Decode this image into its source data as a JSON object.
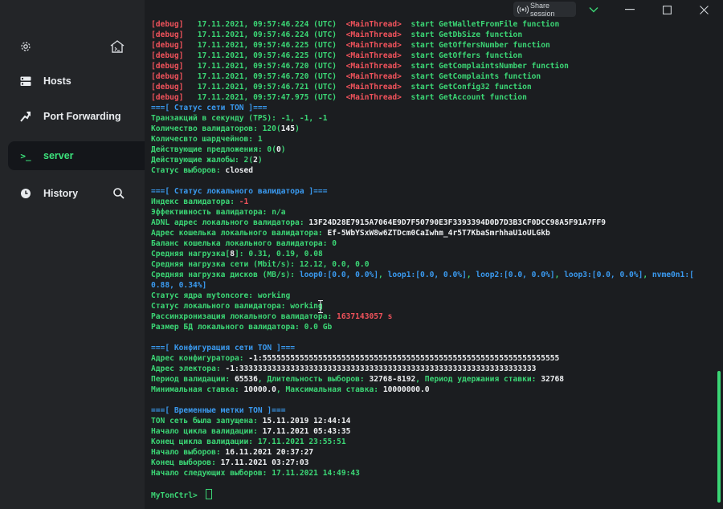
{
  "sidebar": {
    "hosts_label": "Hosts",
    "port_forwarding_label": "Port Forwarding",
    "server_label": "server",
    "history_label": "History",
    "server_icon_text": ">_"
  },
  "titlebar": {
    "share_session_label": "Share session"
  },
  "colors": {
    "accent_green": "#3bd675",
    "debug_red": "#f0525b",
    "info_blue": "#3a9af0"
  },
  "terminal": {
    "debug_lines": [
      {
        "tag": "[debug]",
        "time": "17.11.2021, 09:57:46.224 (UTC)",
        "thread": "<MainThread>",
        "msg": "start GetWalletFromFile function"
      },
      {
        "tag": "[debug]",
        "time": "17.11.2021, 09:57:46.224 (UTC)",
        "thread": "<MainThread>",
        "msg": "start GetDbSize function"
      },
      {
        "tag": "[debug]",
        "time": "17.11.2021, 09:57:46.225 (UTC)",
        "thread": "<MainThread>",
        "msg": "start GetOffersNumber function"
      },
      {
        "tag": "[debug]",
        "time": "17.11.2021, 09:57:46.225 (UTC)",
        "thread": "<MainThread>",
        "msg": "start GetOffers function"
      },
      {
        "tag": "[debug]",
        "time": "17.11.2021, 09:57:46.720 (UTC)",
        "thread": "<MainThread>",
        "msg": "start GetComplaintsNumber function"
      },
      {
        "tag": "[debug]",
        "time": "17.11.2021, 09:57:46.720 (UTC)",
        "thread": "<MainThread>",
        "msg": "start GetComplaints function"
      },
      {
        "tag": "[debug]",
        "time": "17.11.2021, 09:57:46.721 (UTC)",
        "thread": "<MainThread>",
        "msg": "start GetConfig32 function"
      },
      {
        "tag": "[debug]",
        "time": "17.11.2021, 09:57:47.975 (UTC)",
        "thread": "<MainThread>",
        "msg": "start GetAccount function"
      }
    ],
    "net_status": {
      "header": "===[ Статус сети TON ]===",
      "tps_label": "Транзакций в секунду (TPS): ",
      "tps_value": "-1, -1, -1",
      "validators_label": "Количество валидаторов: ",
      "validators_value": "120",
      "validators_paren_open": "(",
      "validators_total": "145",
      "validators_paren_close": ")",
      "shards_label": "Количесвто шардчейнов: ",
      "shards_value": "1",
      "offers_label": "Действующие предложения: ",
      "offers_value": "0",
      "offers_paren_open": "(",
      "offers_total": "0",
      "offers_paren_close": ")",
      "complaints_label": "Действующие жалобы: ",
      "complaints_value": "2",
      "complaints_paren_open": "(",
      "complaints_total": "2",
      "complaints_paren_close": ")",
      "election_label": "Статус выборов: ",
      "election_value": "closed"
    },
    "local_validator": {
      "header": "===[ Статус локального валидатора ]===",
      "index_label": "Индекс валидатора: ",
      "index_value": "-1",
      "efficiency_label": "Эффективность валидатора: ",
      "efficiency_value": "n/a",
      "adnl_label": "ADNL адрес локального валидатора: ",
      "adnl_value": "13F24D28E7915A7064E9D7F50790E3F3393394D0D7D3B3CF0DCC98A5F91A7FF9",
      "wallet_label": "Адрес кошелька локального валидатора: ",
      "wallet_value": "Ef-5WbYSxW8w6ZTDcm0CaIwhm_4r5T7KbaSmrhhaU1oULGkb",
      "balance_label": "Баланс кошелька локального валидатора: ",
      "balance_value": "0",
      "load_label": "Средняя нагрузка",
      "load_bracket_open": "[",
      "load_cores": "8",
      "load_bracket_close": "]",
      "load_colon": ": ",
      "load_value": "0.31, 0.19, 0.08",
      "net_load_label": "Средняя нагрузка сети (Mbit/s): ",
      "net_load_value": "12.12, 0.0, 0.0",
      "disk_label": "Средняя нагрузка дисков (MB/s): ",
      "disk_loop0": "loop0:[0.0, 0.0%]",
      "disk_sep": ", ",
      "disk_loop1": "loop1:[0.0, 0.0%]",
      "disk_loop2": "loop2:[0.0, 0.0%]",
      "disk_loop3": "loop3:[0.0, 0.0%]",
      "disk_nvme_a": "nvme0n1:[",
      "disk_nvme_b": "0.88, 0.34%]",
      "core_label": "Статус ядра mytoncore: ",
      "core_value": "working",
      "local_label": "Статус локального валидатора: ",
      "local_value": "working",
      "desync_label": "Рассинхронизация локального валидатора: ",
      "desync_value": "1637143057 s",
      "db_label": "Размер БД локального валидатора: ",
      "db_value": "0.0 Gb"
    },
    "net_config": {
      "header": "===[ Конфигурация сети TON ]===",
      "config_label": "Адрес конфигуратора: ",
      "config_value": "-1:5555555555555555555555555555555555555555555555555555555555555555",
      "elector_label": "Адрес электора: ",
      "elector_value": "-1:3333333333333333333333333333333333333333333333333333333333333333",
      "period_label": "Период валидации: ",
      "period_value": "65536",
      "duration_label": ", Длительность выборов: ",
      "duration_value": "32768-8192",
      "hold_label": ", Период удержания ставки: ",
      "hold_value": "32768",
      "minstake_label": "Минимальная ставка: ",
      "minstake_value": "10000.0",
      "maxstake_label": ", Максимальная ставка: ",
      "maxstake_value": "10000000.0"
    },
    "timestamps": {
      "header": "===[ Временные метки TON ]===",
      "launched_label": "TON сеть была запущена: ",
      "launched_value": "15.11.2019 12:44:14",
      "cycle_start_label": "Начало цикла валидации: ",
      "cycle_start_value": "17.11.2021 05:43:35",
      "cycle_end_label": "Конец цикла валидации: ",
      "cycle_end_value": "17.11.2021 23:55:51",
      "elections_start_label": "Начало выборов: ",
      "elections_start_value": "16.11.2021 20:37:27",
      "elections_end_label": "Конец выборов: ",
      "elections_end_value": "17.11.2021 03:27:03",
      "next_elections_label": "Начало следующих выборов: ",
      "next_elections_value": "17.11.2021 14:49:43"
    },
    "prompt": "MyTonCtrl> "
  }
}
